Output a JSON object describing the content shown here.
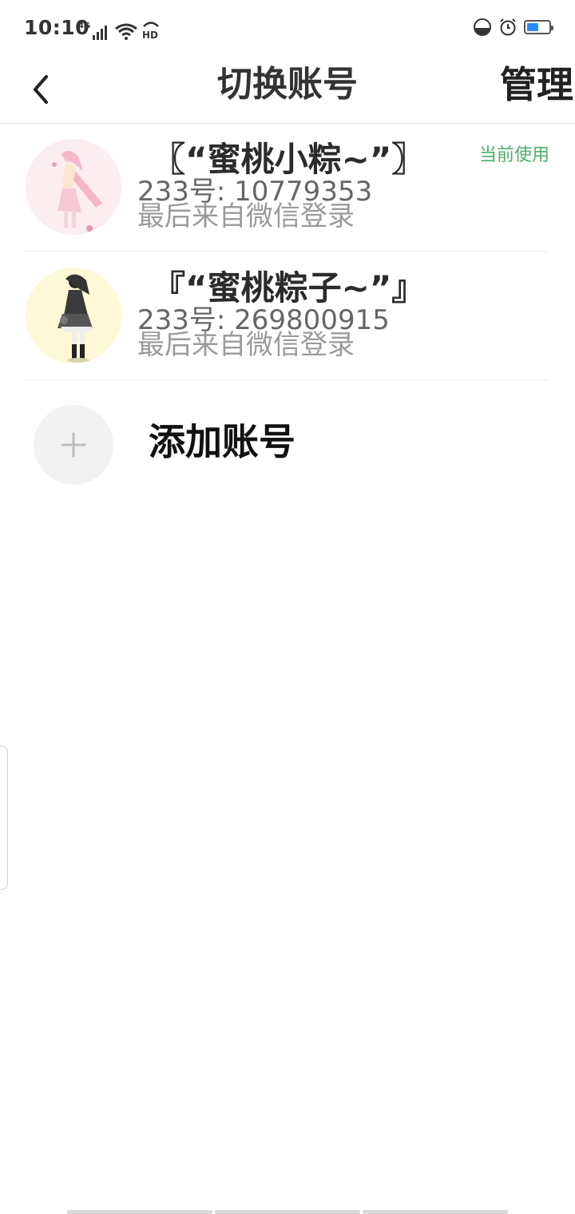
{
  "status_bar": {
    "time": "10:10",
    "network": "4G",
    "wifi_badge": "HD"
  },
  "header": {
    "title": "切换账号",
    "manage_label": "管理",
    "back_icon": "chevron-left-icon"
  },
  "accounts": [
    {
      "name": "〖“蜜桃小粽~”〗",
      "id_line": "233号: 10779353",
      "last_login": "最后来自微信登录",
      "badge": "当前使用",
      "avatar_color": "#fbe9ee"
    },
    {
      "name": "『“蜜桃粽子~”』",
      "id_line": "233号: 269800915",
      "last_login": "最后来自微信登录",
      "avatar_color": "#fdf8d8"
    }
  ],
  "add_account": {
    "label": "添加账号",
    "icon": "plus-icon"
  },
  "colors": {
    "accent_green": "#4caf6a",
    "battery_fill": "#2b8cff"
  }
}
